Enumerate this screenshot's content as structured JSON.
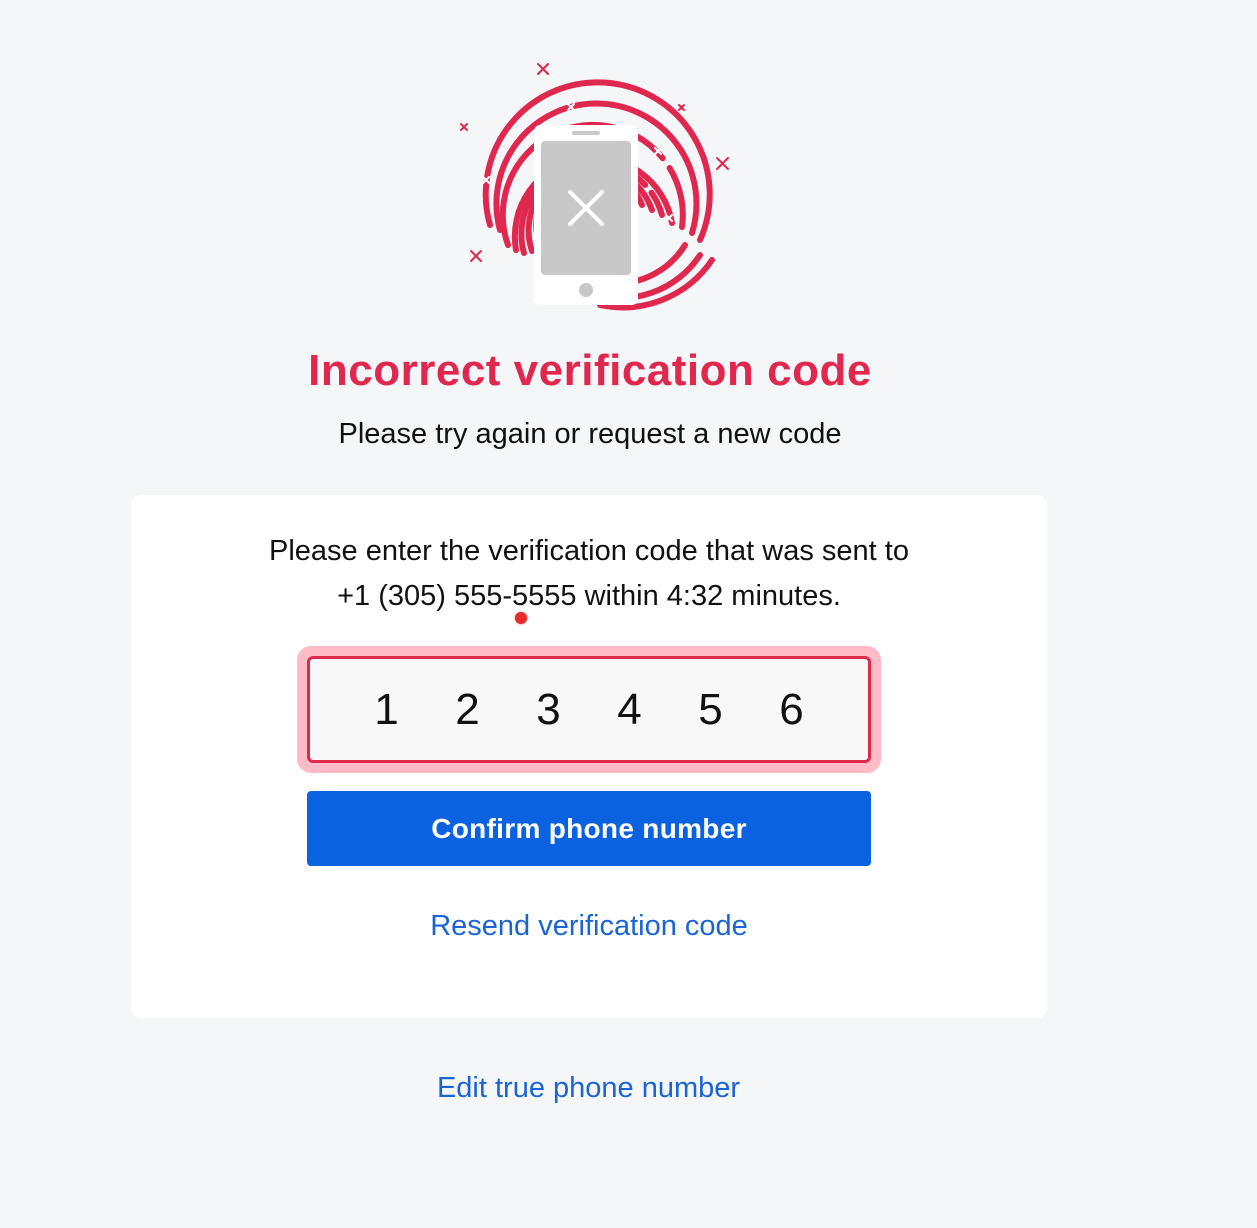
{
  "header": {
    "title": "Incorrect verification code",
    "subtitle": "Please try again or request a new code"
  },
  "card": {
    "instructions_line1": "Please enter the verification code that was sent to",
    "instructions_line2": "+1 (305) 555-5555 within 4:32 minutes.",
    "code_digits": [
      "1",
      "2",
      "3",
      "4",
      "5",
      "6"
    ],
    "confirm_label": "Confirm phone number",
    "resend_label": "Resend verification code"
  },
  "footer": {
    "edit_label": "Edit true phone number"
  },
  "colors": {
    "error": "#e0284f",
    "error_glow": "#ffbcc7",
    "primary": "#0a62e0",
    "link": "#1a64d6",
    "background": "#f5f6f8"
  },
  "icons": {
    "illustration": "fingerprint-phone-error-icon"
  }
}
